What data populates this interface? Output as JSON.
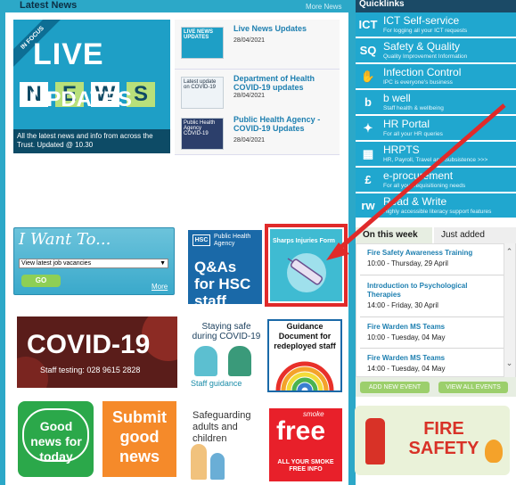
{
  "latest_news": {
    "heading": "Latest News",
    "more": "More News",
    "hero": {
      "ribbon": "IN FOCUS",
      "line1": "LIVE",
      "letters": [
        "N",
        "E",
        "W",
        "S"
      ],
      "line3": "UPDATES",
      "caption": "All the latest news and info from across the Trust. Updated @ 10.30"
    },
    "items": [
      {
        "thumb": "LIVE NEWS UPDATES",
        "title": "Live News Updates",
        "date": "28/04/2021"
      },
      {
        "thumb": "Latest update on COVID-19",
        "title": "Department of Health COVID-19 updates",
        "date": "28/04/2021"
      },
      {
        "thumb": "Public Health Agency COVID-19",
        "title": "Public Health Agency - COVID-19 Updates",
        "date": "28/04/2021"
      }
    ]
  },
  "quicklinks": {
    "heading": "Quicklinks",
    "items": [
      {
        "icon": "ICT",
        "title": "ICT Self-service",
        "sub": "For logging all your ICT requests"
      },
      {
        "icon": "SQ",
        "title": "Safety & Quality",
        "sub": "Quality Improvement Information"
      },
      {
        "icon": "✋",
        "title": "Infection Control",
        "sub": "IPC is everyone's business"
      },
      {
        "icon": "b",
        "title": "b well",
        "sub": "Staff health & wellbeing"
      },
      {
        "icon": "✦",
        "title": "HR Portal",
        "sub": "For all your HR queries"
      },
      {
        "icon": "▦",
        "title": "HRPTS",
        "sub": "HR, Payroll, Travel and Subsistence >>>"
      },
      {
        "icon": "£",
        "title": "e-procurement",
        "sub": "For all your requisitioning needs"
      },
      {
        "icon": "rw",
        "title": "Read & Write",
        "sub": "Highly accessible literacy support features"
      }
    ]
  },
  "events": {
    "tab_week": "On this week",
    "tab_added": "Just added",
    "items": [
      {
        "title": "Fire Safety Awareness Training",
        "when": "10:00 - Thursday, 29 April"
      },
      {
        "title": "Introduction to Psychological Therapies",
        "when": "14:00 - Friday, 30 April"
      },
      {
        "title": "Fire Warden MS Teams",
        "when": "10:00 - Tuesday, 04 May"
      },
      {
        "title": "Fire Warden MS Teams",
        "when": "14:00 - Tuesday, 04 May"
      }
    ],
    "add_button": "ADD NEW EVENT",
    "view_button": "VIEW ALL EVENTS"
  },
  "want": {
    "title": "I Want To...",
    "select_value": "View latest job vacancies",
    "go": "GO",
    "more": "More"
  },
  "tiles": {
    "qa": {
      "badge": "HSC",
      "agency": "Public Health Agency",
      "text": "Q&As for HSC staff"
    },
    "sharps": {
      "title": "Sharps Injuries Form"
    },
    "covid": {
      "title": "COVID-19",
      "sub": "Staff testing: 028 9615 2828"
    },
    "staying": {
      "title": "Staying safe during COVID-19",
      "sub": "Staff guidance"
    },
    "guidance": {
      "title": "Guidance Document for redeployed staff"
    },
    "goodnews": {
      "text": "Good news for today"
    },
    "submit": {
      "text": "Submit good news"
    },
    "safeguard": {
      "title": "Safeguarding adults and children"
    },
    "smoke": {
      "tag": "smoke",
      "free": "free",
      "sub": "ALL YOUR SMOKE FREE INFO"
    },
    "fire": {
      "text": "FIRE SAFETY"
    }
  },
  "colors": {
    "accent": "#20a7cf",
    "frame": "#2ca8c8",
    "arrow": "#e02a2a",
    "title_blue": "#1d7fb0"
  }
}
